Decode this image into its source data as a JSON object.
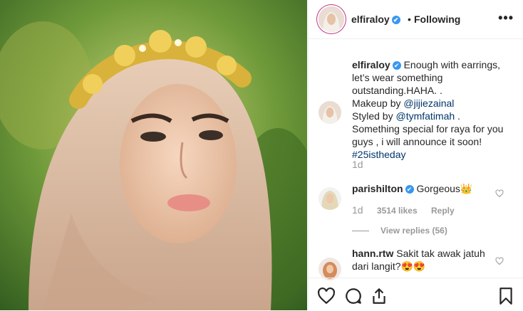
{
  "header": {
    "username": "elfiraloy",
    "verified_mark": "✔",
    "separator": "•",
    "following_label": "Following",
    "more_label": "•••"
  },
  "caption": {
    "username": "elfiraloy",
    "verified_mark": "✔",
    "line1": " Enough with earrings, let’s wear something outstanding.HAHA. .",
    "makeup_prefix": "Makeup by ",
    "makeup_link": "@jijiezainal",
    "styled_prefix": "Styled by ",
    "styled_link": "@tymfatimah",
    "styled_suffix": " .",
    "line2": "Something special for raya for you guys , i will announce it soon!",
    "hashtag": "#25istheday",
    "time": "1d"
  },
  "comments": [
    {
      "username": "parishilton",
      "verified_mark": "✔",
      "text": " Gorgeous👑",
      "time": "1d",
      "likes": "3514 likes",
      "reply_label": "Reply",
      "view_replies": "View replies (56)"
    },
    {
      "username": "hann.rtw",
      "text": " Sakit tak awak jatuh dari langit?😍😍"
    }
  ],
  "actions": [
    "heart-icon",
    "comment-icon",
    "share-icon",
    "bookmark-icon"
  ],
  "colors": {
    "link": "#003569",
    "verified": "#3897f0",
    "muted": "#999999",
    "story_ring": "#c13584"
  }
}
